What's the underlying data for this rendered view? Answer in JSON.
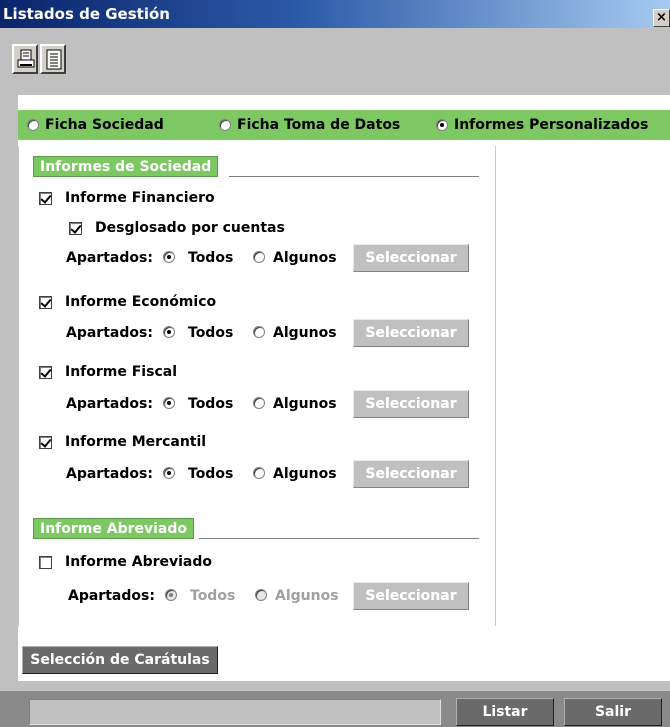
{
  "window": {
    "title": "Listados de Gestión",
    "close_label": "×"
  },
  "toolbar": {
    "buttons": [
      "printer-icon",
      "list-icon"
    ]
  },
  "report_types": [
    {
      "label": "Ficha Sociedad",
      "checked": false
    },
    {
      "label": "Ficha Toma de Datos",
      "checked": false
    },
    {
      "label": "Informes Personalizados",
      "checked": true
    }
  ],
  "sections": {
    "sociedad": {
      "title": "Informes de Sociedad",
      "financiero": {
        "label": "Informe Financiero",
        "checked": true,
        "desglosado": {
          "label": "Desglosado por cuentas",
          "checked": true
        }
      },
      "economico": {
        "label": "Informe Económico",
        "checked": true
      },
      "fiscal": {
        "label": "Informe Fiscal",
        "checked": true
      },
      "mercantil": {
        "label": "Informe Mercantil",
        "checked": true
      }
    },
    "abreviado": {
      "title": "Informe Abreviado",
      "item": {
        "label": "Informe Abreviado",
        "checked": false
      }
    }
  },
  "apartados": {
    "label": "Apartados:",
    "todos": "Todos",
    "algunos": "Algunos",
    "select_button": "Seleccionar"
  },
  "buttons": {
    "caratulas": "Selección de Carátulas",
    "listar": "Listar",
    "salir": "Salir"
  },
  "colors": {
    "accent_green": "#7ec864",
    "title_blue": "#0a246a"
  }
}
